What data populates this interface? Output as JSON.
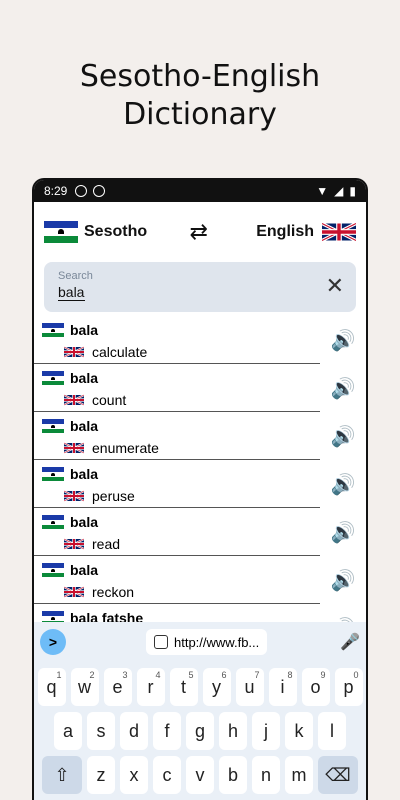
{
  "promo": {
    "line1": "Sesotho-English",
    "line2": "Dictionary"
  },
  "status": {
    "time": "8:29"
  },
  "langbar": {
    "source": "Sesotho",
    "target": "English"
  },
  "search": {
    "placeholder": "Search",
    "value": "bala"
  },
  "results": [
    {
      "term": "bala",
      "translation": "calculate"
    },
    {
      "term": "bala",
      "translation": "count"
    },
    {
      "term": "bala",
      "translation": "enumerate"
    },
    {
      "term": "bala",
      "translation": "peruse"
    },
    {
      "term": "bala",
      "translation": "read"
    },
    {
      "term": "bala",
      "translation": "reckon"
    },
    {
      "term": "bala fatshe",
      "translation": ""
    }
  ],
  "keyboard": {
    "clipboard": "http://www.fb...",
    "row1": [
      "q",
      "w",
      "e",
      "r",
      "t",
      "y",
      "u",
      "i",
      "o",
      "p"
    ],
    "row1_nums": [
      "1",
      "2",
      "3",
      "4",
      "5",
      "6",
      "7",
      "8",
      "9",
      "0"
    ],
    "row2": [
      "a",
      "s",
      "d",
      "f",
      "g",
      "h",
      "j",
      "k",
      "l"
    ],
    "row3": [
      "z",
      "x",
      "c",
      "v",
      "b",
      "n",
      "m"
    ]
  },
  "colors": {
    "flag_blue": "#1a3aa8",
    "flag_green": "#0b8a3a",
    "search_bg": "#dfe5ed",
    "kbd_bg": "#eaf0f7",
    "accent": "#6ebcf7"
  }
}
